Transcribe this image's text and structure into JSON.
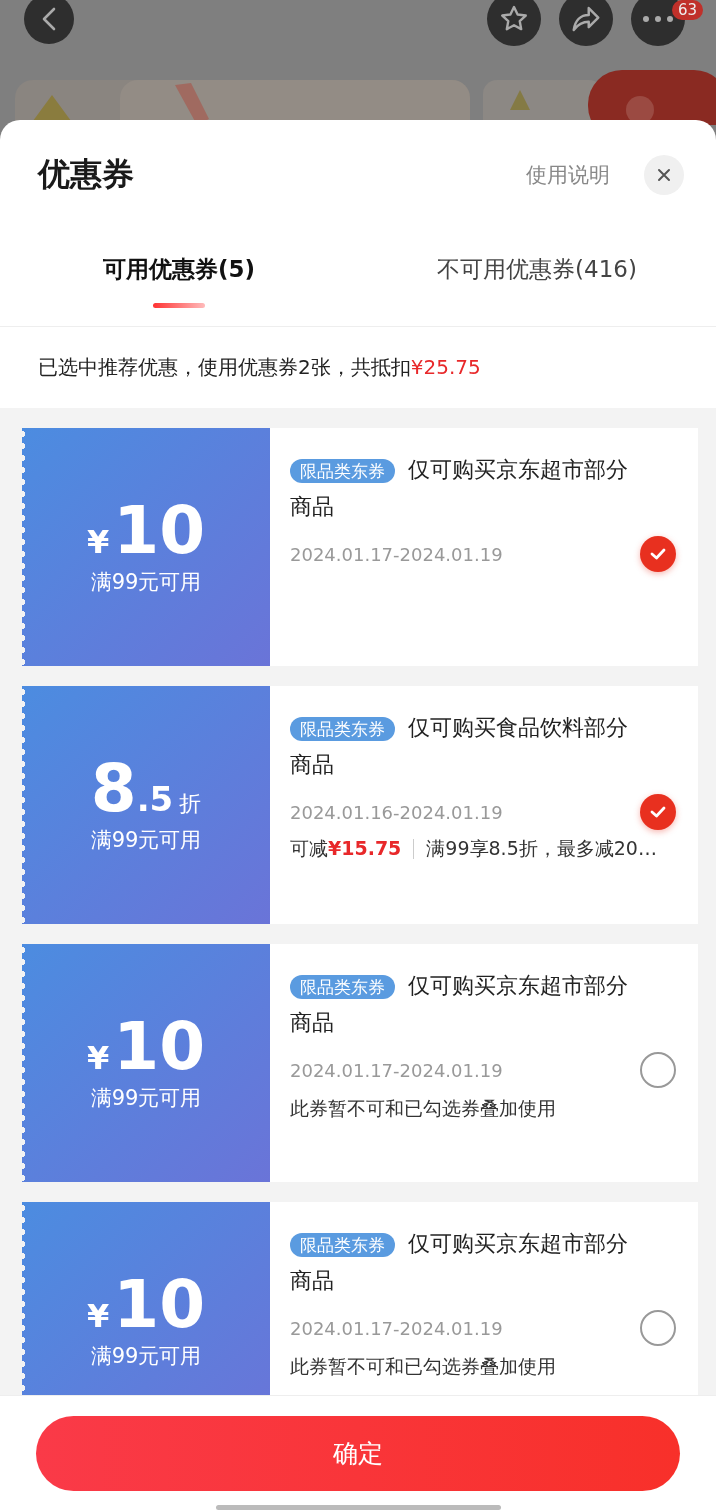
{
  "top_bar": {
    "badge": "63"
  },
  "sheet": {
    "title": "优惠券",
    "help_link": "使用说明"
  },
  "tabs": [
    {
      "label": "可用优惠券(5)",
      "selected": true
    },
    {
      "label": "不可用优惠券(416)",
      "selected": false
    }
  ],
  "summary": {
    "text": "已选中推荐优惠，使用优惠券2张，共抵扣",
    "amount": "¥25.75"
  },
  "coupons": [
    {
      "kind": "amount",
      "prefix": "¥",
      "main": "10",
      "condition": "满99元可用",
      "tag": "限品类东券",
      "title": "仅可购买京东超市部分商品",
      "dates": "2024.01.17-2024.01.19",
      "checked": true
    },
    {
      "kind": "discount",
      "main": "8",
      "fraction": ".5",
      "suffix": "折",
      "condition": "满99元可用",
      "tag": "限品类东券",
      "title": "仅可购买食品饮料部分商品",
      "dates": "2024.01.16-2024.01.19",
      "checked": true,
      "savings_label": "可减",
      "savings_amount": "¥15.75",
      "savings_detail": "满99享8.5折，最多减20…"
    },
    {
      "kind": "amount",
      "prefix": "¥",
      "main": "10",
      "condition": "满99元可用",
      "tag": "限品类东券",
      "title": "仅可购买京东超市部分商品",
      "dates": "2024.01.17-2024.01.19",
      "checked": false,
      "note": "此券暂不可和已勾选券叠加使用"
    },
    {
      "kind": "amount",
      "prefix": "¥",
      "main": "10",
      "condition": "满99元可用",
      "tag": "限品类东券",
      "title": "仅可购买京东超市部分商品",
      "dates": "2024.01.17-2024.01.19",
      "checked": false,
      "note": "此券暂不可和已勾选券叠加使用"
    }
  ],
  "confirm_button": "确定"
}
